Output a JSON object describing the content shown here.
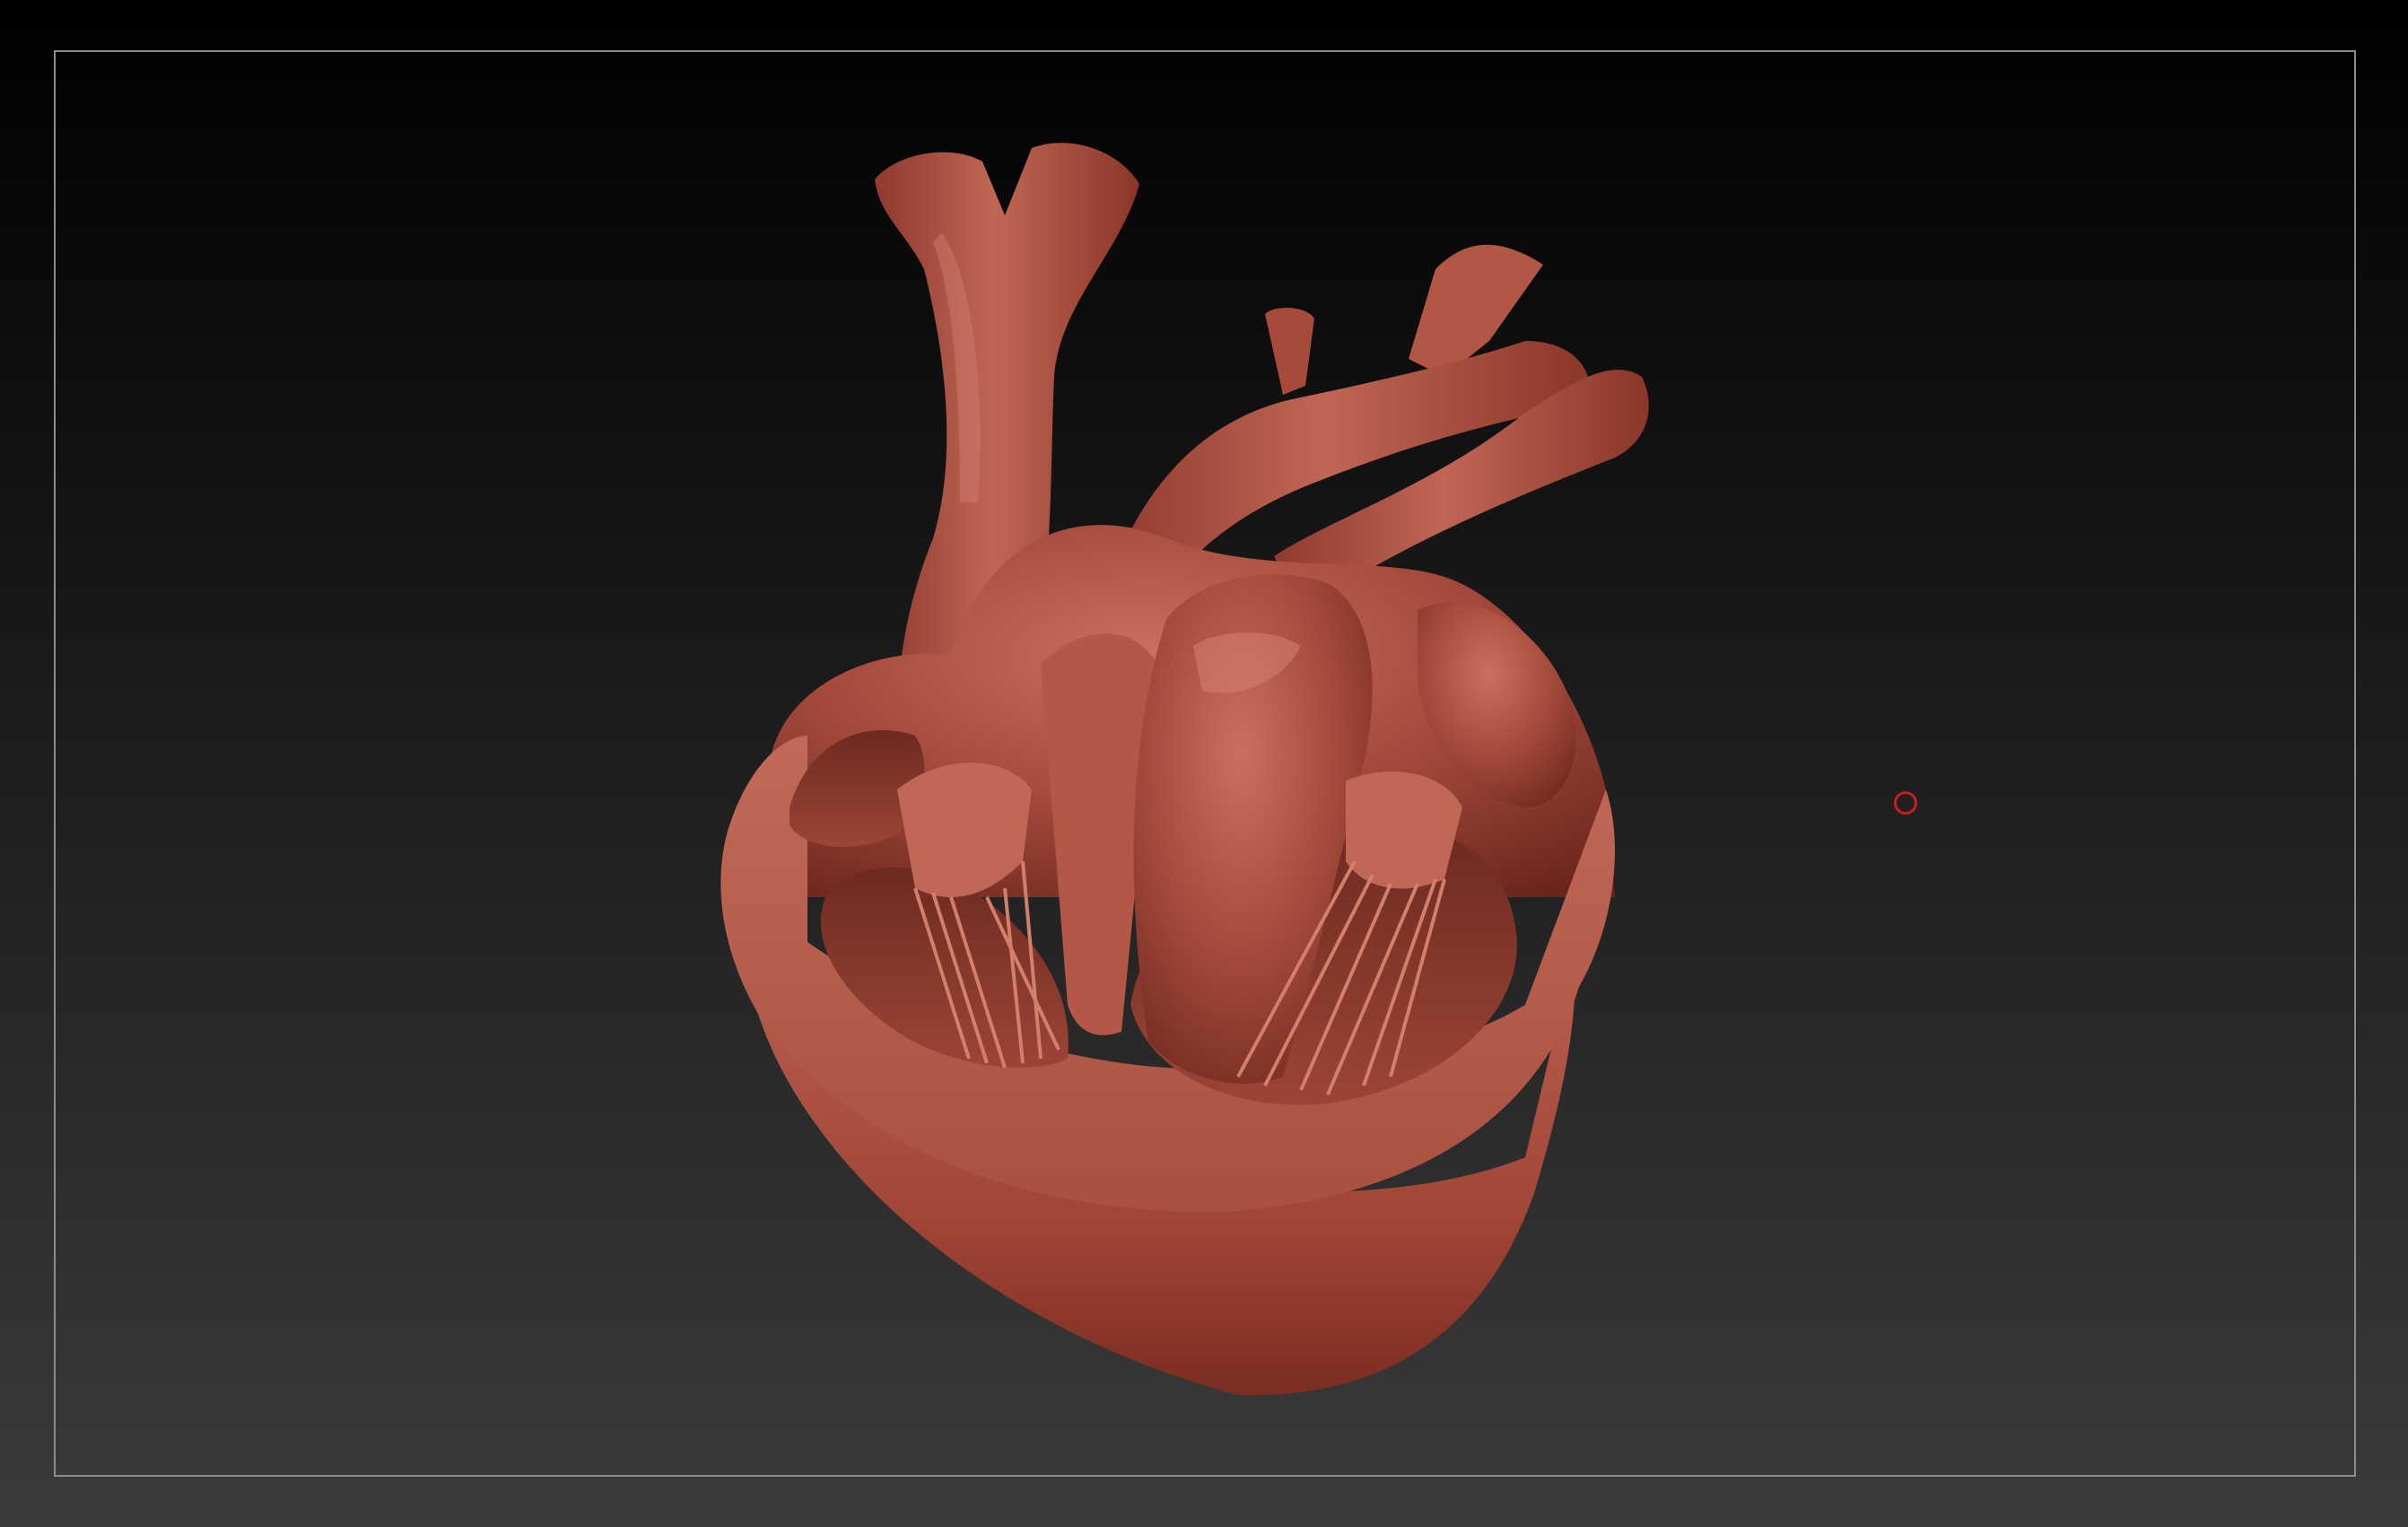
{
  "viewport": {
    "background_top": "#000000",
    "background_bottom": "#3b3b3b",
    "frame_color": "#8c8c8c"
  },
  "model": {
    "subject": "heart-cross-section",
    "material_color": "#a4473a",
    "highlight_color": "#c86a5a",
    "shadow_color": "#5a1e16"
  },
  "cursor": {
    "icon": "brush-circle-icon",
    "color": "#c81e1e"
  }
}
